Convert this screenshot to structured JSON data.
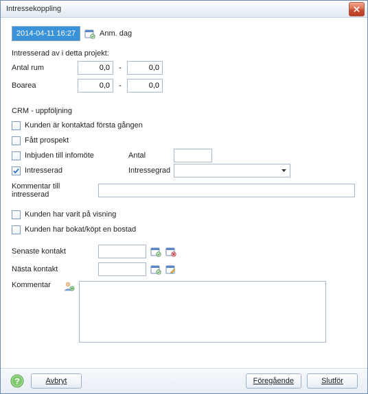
{
  "title": "Intressekoppling",
  "anmdag": {
    "date": "2014-04-11 16:27",
    "label": "Anm. dag"
  },
  "intresserad_label": "Intresserad av i detta projekt:",
  "antal_rum": {
    "label": "Antal rum",
    "from": "0,0",
    "to": "0,0"
  },
  "boarea": {
    "label": "Boarea",
    "from": "0,0",
    "to": "0,0"
  },
  "crm_label": "CRM - uppföljning",
  "crm": {
    "kontaktad": {
      "label": "Kunden är kontaktad första gången",
      "checked": false
    },
    "prospekt": {
      "label": "Fått prospekt",
      "checked": false
    },
    "infomote": {
      "label": "Inbjuden till infomöte",
      "checked": false
    },
    "intresserad": {
      "label": "Intresserad",
      "checked": true
    },
    "antal_label": "Antal",
    "antal_value": "",
    "intressegrad_label": "Intressegrad",
    "intressegrad_value": ""
  },
  "kommentar_intresserad": {
    "label": "Kommentar till intresserad",
    "value": ""
  },
  "visning": {
    "label": "Kunden har varit på visning",
    "checked": false
  },
  "bokat": {
    "label": "Kunden har bokat/köpt en bostad",
    "checked": false
  },
  "senaste": {
    "label": "Senaste kontakt",
    "value": ""
  },
  "nasta": {
    "label": "Nästa kontakt",
    "value": ""
  },
  "kommentar": {
    "label": "Kommentar",
    "value": ""
  },
  "buttons": {
    "avbryt": "Avbryt",
    "foregaende": "Föregående",
    "slutfor": "Slutför"
  }
}
